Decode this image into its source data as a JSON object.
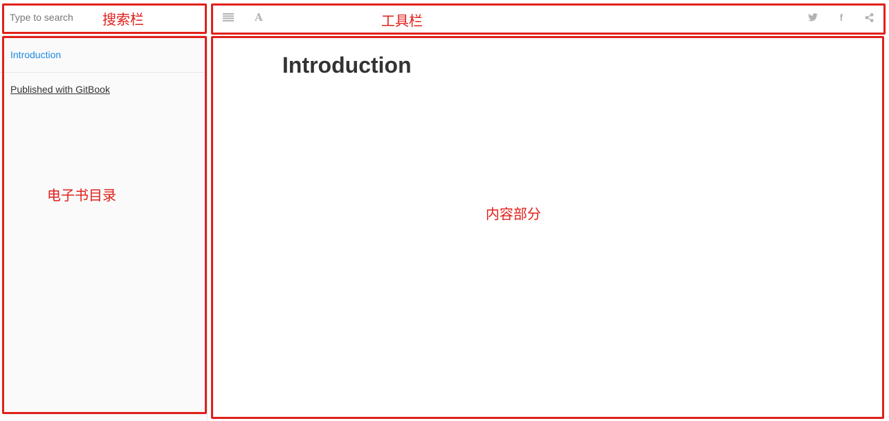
{
  "search": {
    "placeholder": "Type to search"
  },
  "toc": {
    "items": [
      {
        "label": "Introduction",
        "active": true
      },
      {
        "label": "Published with GitBook"
      }
    ]
  },
  "toolbar": {
    "left_icons": [
      "menu-icon",
      "font-icon"
    ],
    "right_icons": [
      "twitter-icon",
      "facebook-icon",
      "share-icon"
    ]
  },
  "page": {
    "title": "Introduction"
  },
  "annotations": {
    "search_bar": "搜索栏",
    "toolbar": "工具栏",
    "toc": "电子书目录",
    "content": "内容部分"
  },
  "colors": {
    "link": "#1e88e5",
    "annotation": "#e0201a",
    "icon": "#b3b3b3"
  }
}
